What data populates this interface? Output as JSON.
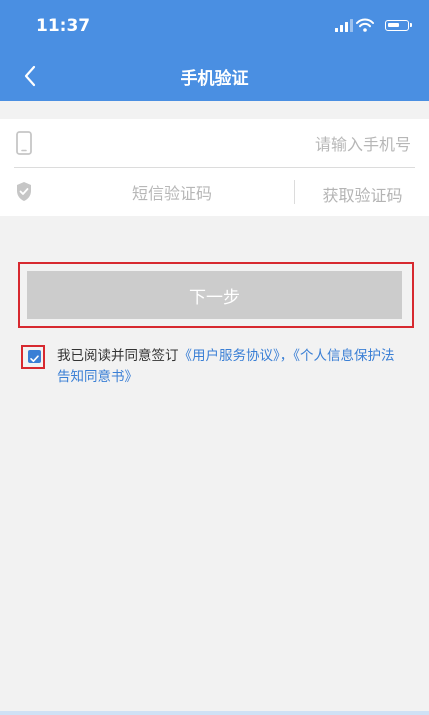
{
  "status_bar": {
    "time": "11:37"
  },
  "nav": {
    "title": "手机验证"
  },
  "form": {
    "phone_placeholder": "请输入手机号",
    "code_placeholder": "短信验证码",
    "get_code_label": "获取验证码"
  },
  "next_button": {
    "label": "下一步"
  },
  "agreement": {
    "checked": true,
    "prefix": "我已阅读并同意签订",
    "link1": "《用户服务协议》",
    "separator": "，",
    "link2": "《个人信息保护法告知同意书》"
  },
  "colors": {
    "primary": "#4a8fe2",
    "link": "#3a7fd5",
    "highlight": "#d7292f",
    "disabled_button": "#cccccc"
  }
}
